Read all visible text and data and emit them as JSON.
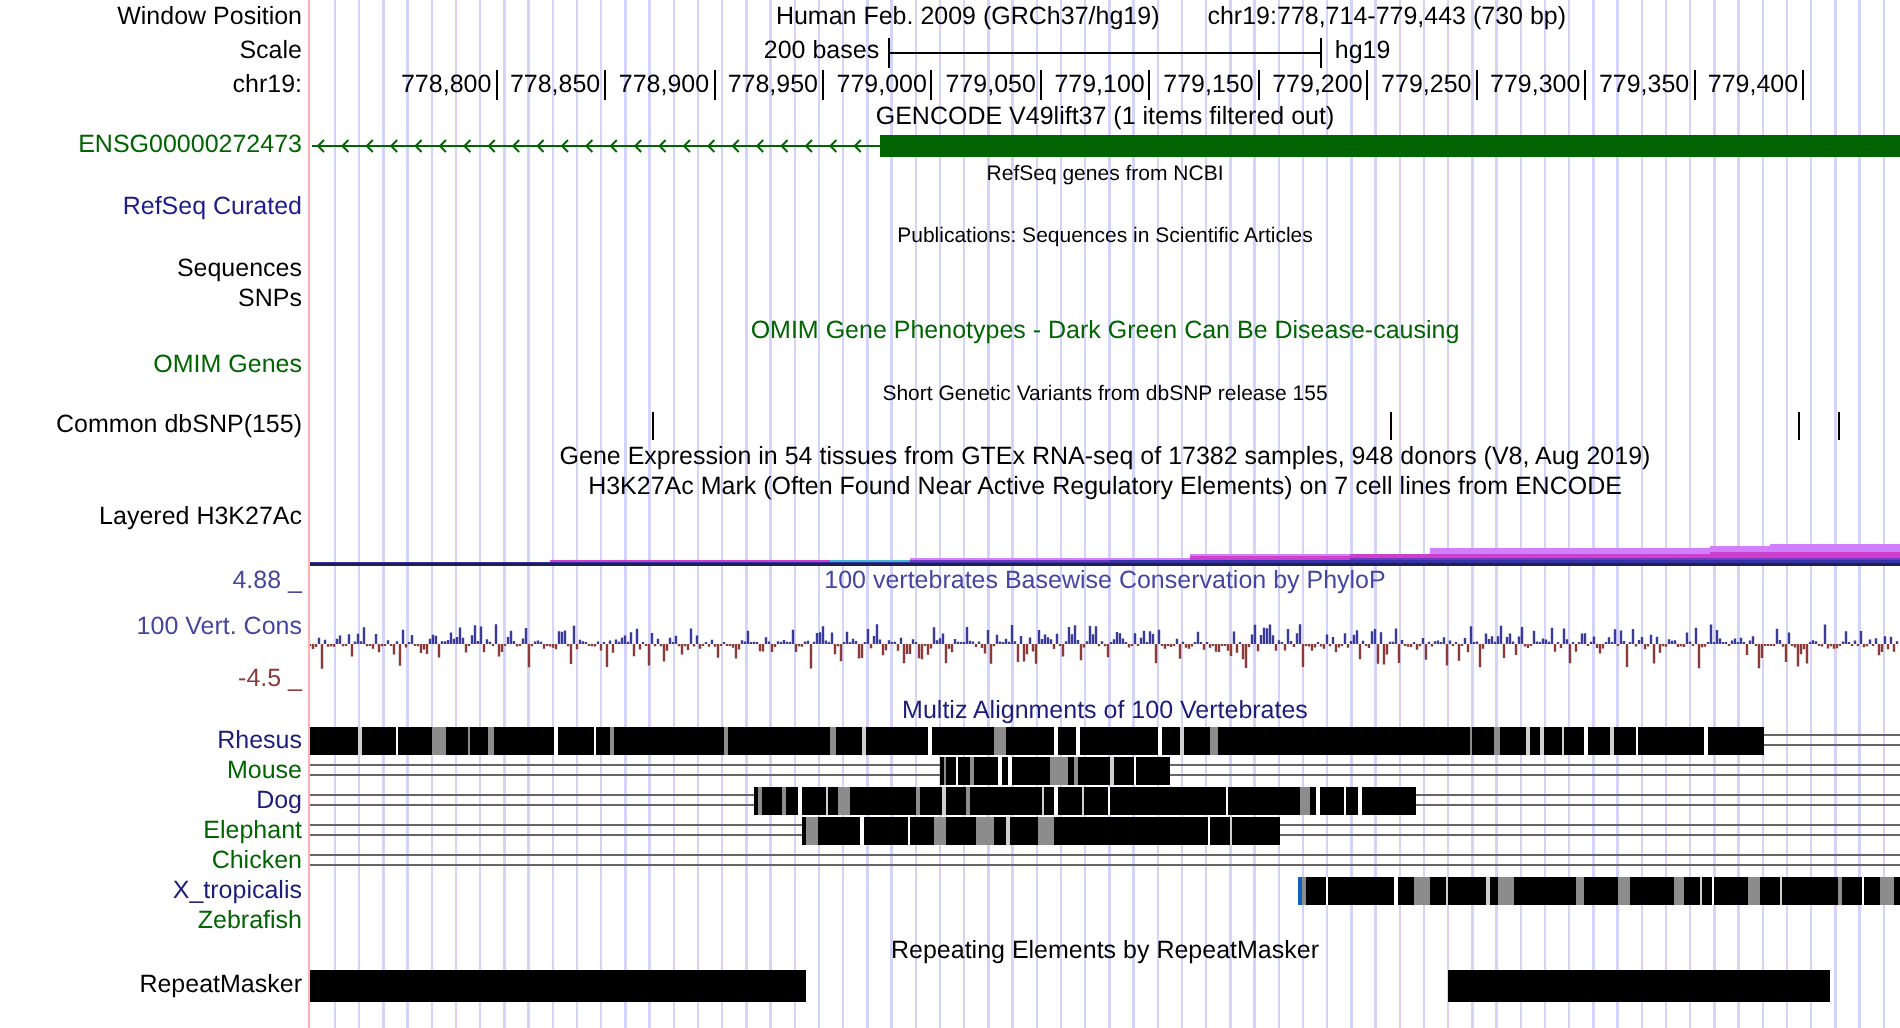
{
  "header": {
    "window_position_label": "Window Position",
    "assembly": "Human Feb. 2009 (GRCh37/hg19)",
    "position": "chr19:778,714-779,443 (730 bp)",
    "scale_label": "Scale",
    "scale_text": "200 bases",
    "scale_db": "hg19",
    "chrom_label": "chr19:",
    "ruler_ticks": [
      "778,800",
      "778,850",
      "778,900",
      "778,950",
      "779,000",
      "779,050",
      "779,100",
      "779,150",
      "779,200",
      "779,250",
      "779,300",
      "779,350",
      "779,400"
    ]
  },
  "tracks": [
    {
      "kind": "gene",
      "title": "GENCODE V49lift37 (1 items filtered out)",
      "labels": [
        {
          "text": "ENSG00000272473",
          "color": "#006400"
        }
      ]
    },
    {
      "kind": "listing",
      "title": "RefSeq genes from NCBI",
      "labels": [
        {
          "text": "RefSeq Curated",
          "color": "#1c1c8a"
        }
      ]
    },
    {
      "kind": "listing",
      "title": "Publications: Sequences in Scientific Articles",
      "labels": [
        {
          "text": "Sequences",
          "color": "#000000"
        },
        {
          "text": "SNPs",
          "color": "#000000"
        }
      ]
    },
    {
      "kind": "plain",
      "title": "OMIM Gene Phenotypes - Dark Green Can Be Disease-causing",
      "color": "#006400",
      "labels": [
        {
          "text": "OMIM Genes",
          "color": "#006400"
        }
      ]
    },
    {
      "kind": "snp",
      "title": "Short Genetic Variants from dbSNP release 155",
      "labels": [
        {
          "text": "Common dbSNP(155)",
          "color": "#000000"
        }
      ]
    },
    {
      "kind": "plain",
      "title": "Gene Expression in 54 tissues from GTEx RNA-seq of 17382 samples, 948 donors (V8, Aug 2019)"
    },
    {
      "kind": "layered",
      "title": "H3K27Ac Mark (Often Found Near Active Regulatory Elements) on 7 cell lines from ENCODE",
      "labels": [
        {
          "text": "Layered H3K27Ac",
          "color": "#000000"
        }
      ]
    },
    {
      "kind": "wiggle",
      "title": "100 vertebrates Basewise Conservation by PhyloP",
      "color": "#4646a0",
      "max_label": {
        "text": "4.88 _",
        "color": "#4646a0"
      },
      "labels": [
        {
          "text": "100 Vert. Cons",
          "color": "#4646a0"
        }
      ],
      "min_label": {
        "text": "-4.5 _",
        "color": "#8b3a3a"
      }
    },
    {
      "kind": "multiz",
      "title": "Multiz Alignments of 100 Vertebrates",
      "color": "#1c1c7a",
      "labels": [
        {
          "text": "Rhesus",
          "color": "#1c1c7a"
        },
        {
          "text": "Mouse",
          "color": "#006400"
        },
        {
          "text": "Dog",
          "color": "#1c1c7a"
        },
        {
          "text": "Elephant",
          "color": "#006400"
        },
        {
          "text": "Chicken",
          "color": "#006400"
        },
        {
          "text": "X_tropicalis",
          "color": "#1c1c7a"
        },
        {
          "text": "Zebrafish",
          "color": "#006400"
        }
      ]
    },
    {
      "kind": "repeat",
      "title": "Repeating Elements by RepeatMasker",
      "labels": [
        {
          "text": "RepeatMasker",
          "color": "#000000"
        }
      ]
    }
  ]
}
